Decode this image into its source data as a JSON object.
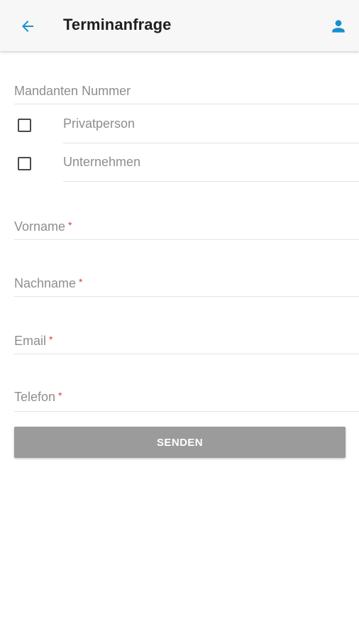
{
  "app_bar": {
    "title": "Terminanfrage",
    "back_icon": "arrow-left-icon",
    "profile_icon": "person-icon",
    "accent_color": "#1a8fd0"
  },
  "form": {
    "client_number": {
      "label": "Mandanten Nummer"
    },
    "customer_type": {
      "options": [
        {
          "label": "Privatperson",
          "checked": false
        },
        {
          "label": "Unternehmen",
          "checked": false
        }
      ]
    },
    "first_name": {
      "label": "Vorname",
      "required_marker": "*"
    },
    "last_name": {
      "label": "Nachname",
      "required_marker": "*"
    },
    "email": {
      "label": "Email",
      "required_marker": "*"
    },
    "phone": {
      "label": "Telefon",
      "required_marker": "*"
    },
    "submit_label": "SENDEN",
    "required_color": "#e03a3a",
    "button_color": "#9b9b9b"
  }
}
